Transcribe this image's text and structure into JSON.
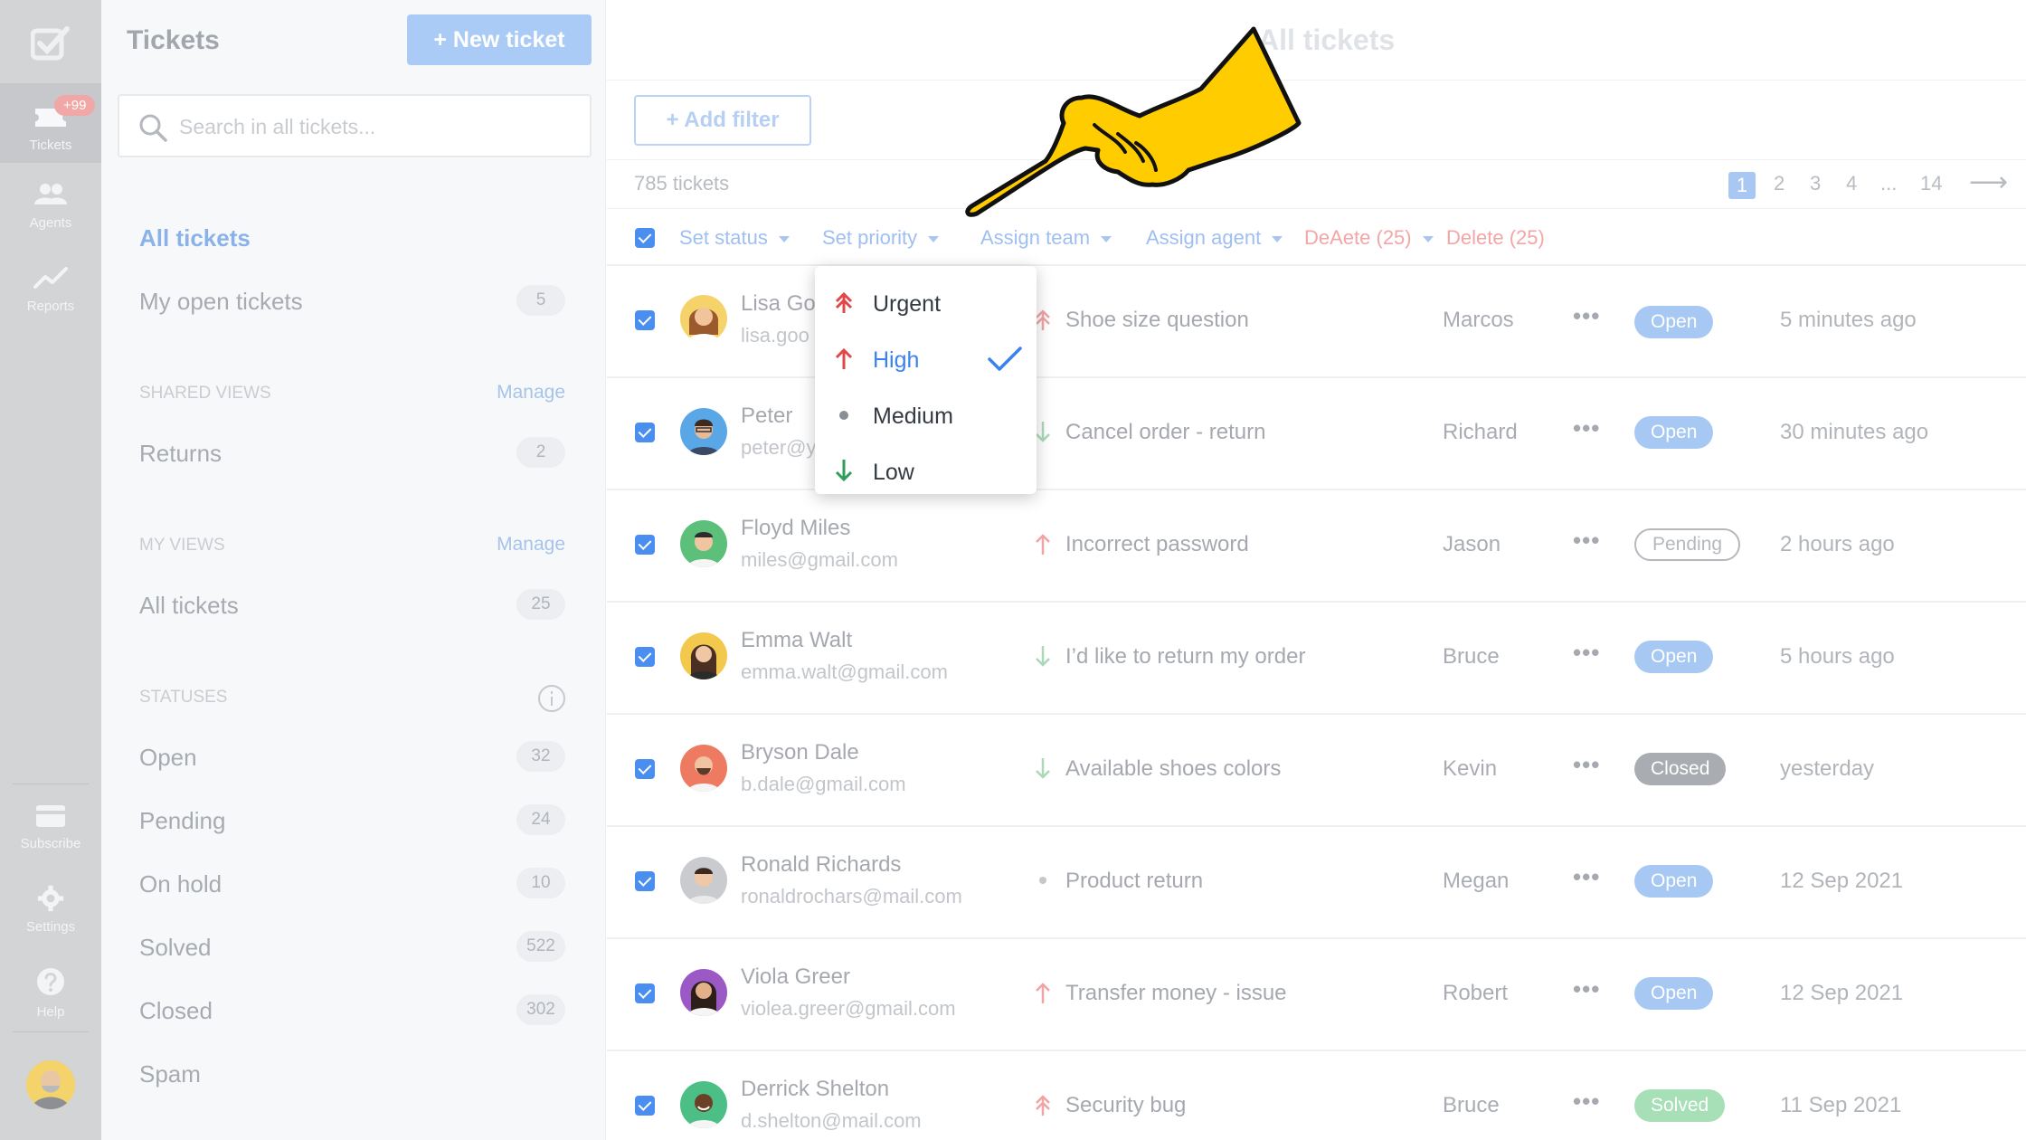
{
  "rail": {
    "tickets_label": "Tickets",
    "tickets_badge": "+99",
    "agents_label": "Agents",
    "reports_label": "Reports",
    "subscribe_label": "Subscribe",
    "settings_label": "Settings",
    "help_label": "Help"
  },
  "sidebar": {
    "title": "Tickets",
    "new_ticket": "+ New ticket",
    "search_placeholder": "Search in all tickets...",
    "all_tickets": "All tickets",
    "my_open_tickets": {
      "label": "My open tickets",
      "count": "5"
    },
    "shared_views_heading": "SHARED VIEWS",
    "shared_manage": "Manage",
    "returns": {
      "label": "Returns",
      "count": "2"
    },
    "my_views_heading": "MY VIEWS",
    "my_manage": "Manage",
    "my_all_tickets": {
      "label": "All tickets",
      "count": "25"
    },
    "statuses_heading": "STATUSES",
    "statuses": [
      {
        "label": "Open",
        "count": "32"
      },
      {
        "label": "Pending",
        "count": "24"
      },
      {
        "label": "On hold",
        "count": "10"
      },
      {
        "label": "Solved",
        "count": "522"
      },
      {
        "label": "Closed",
        "count": "302"
      },
      {
        "label": "Spam",
        "count": ""
      }
    ]
  },
  "main": {
    "title": "All tickets",
    "add_filter": "+ Add filter",
    "ticket_count": "785 tickets",
    "pages": [
      "1",
      "2",
      "3",
      "4",
      "...",
      "14"
    ],
    "next_arrow": "⟶",
    "bulk": {
      "set_status": "Set status",
      "set_priority": "Set priority",
      "assign_team": "Assign team",
      "assign_agent": "Assign agent",
      "overlap_text": "DeAete (25)",
      "delete": "Delete (25)"
    },
    "rows": [
      {
        "name": "Lisa Go",
        "email": "lisa.goo",
        "priority": "urgent",
        "subject": "Shoe size question",
        "agent": "Marcos",
        "status": "Open",
        "time": "5 minutes ago"
      },
      {
        "name": "Peter",
        "email": "peter@y",
        "priority": "low",
        "subject": "Cancel order - return",
        "agent": "Richard",
        "status": "Open",
        "time": "30 minutes ago"
      },
      {
        "name": "Floyd Miles",
        "email": "miles@gmail.com",
        "priority": "high",
        "subject": "Incorrect password",
        "agent": "Jason",
        "status": "Pending",
        "time": "2 hours ago"
      },
      {
        "name": "Emma Walt",
        "email": "emma.walt@gmail.com",
        "priority": "low",
        "subject": "I’d like to return my order",
        "agent": "Bruce",
        "status": "Open",
        "time": "5 hours ago"
      },
      {
        "name": "Bryson Dale",
        "email": "b.dale@gmail.com",
        "priority": "low",
        "subject": "Available shoes colors",
        "agent": "Kevin",
        "status": "Closed",
        "time": "yesterday"
      },
      {
        "name": "Ronald Richards",
        "email": "ronaldrochars@mail.com",
        "priority": "medium",
        "subject": "Product return",
        "agent": "Megan",
        "status": "Open",
        "time": "12 Sep 2021"
      },
      {
        "name": "Viola Greer",
        "email": "violea.greer@gmail.com",
        "priority": "high",
        "subject": "Transfer money - issue",
        "agent": "Robert",
        "status": "Open",
        "time": "12 Sep 2021"
      },
      {
        "name": "Derrick Shelton",
        "email": "d.shelton@mail.com",
        "priority": "urgent",
        "subject": "Security bug",
        "agent": "Bruce",
        "status": "Solved",
        "time": "11 Sep 2021"
      }
    ],
    "more_icon": "•••"
  },
  "priority_menu": {
    "urgent": "Urgent",
    "high": "High",
    "medium": "Medium",
    "low": "Low",
    "selected": "High"
  },
  "colors": {
    "accent": "#3b82f0",
    "urgent": "#e04848",
    "low": "#2e9e58",
    "pointer_hand": "#ffcc00"
  }
}
